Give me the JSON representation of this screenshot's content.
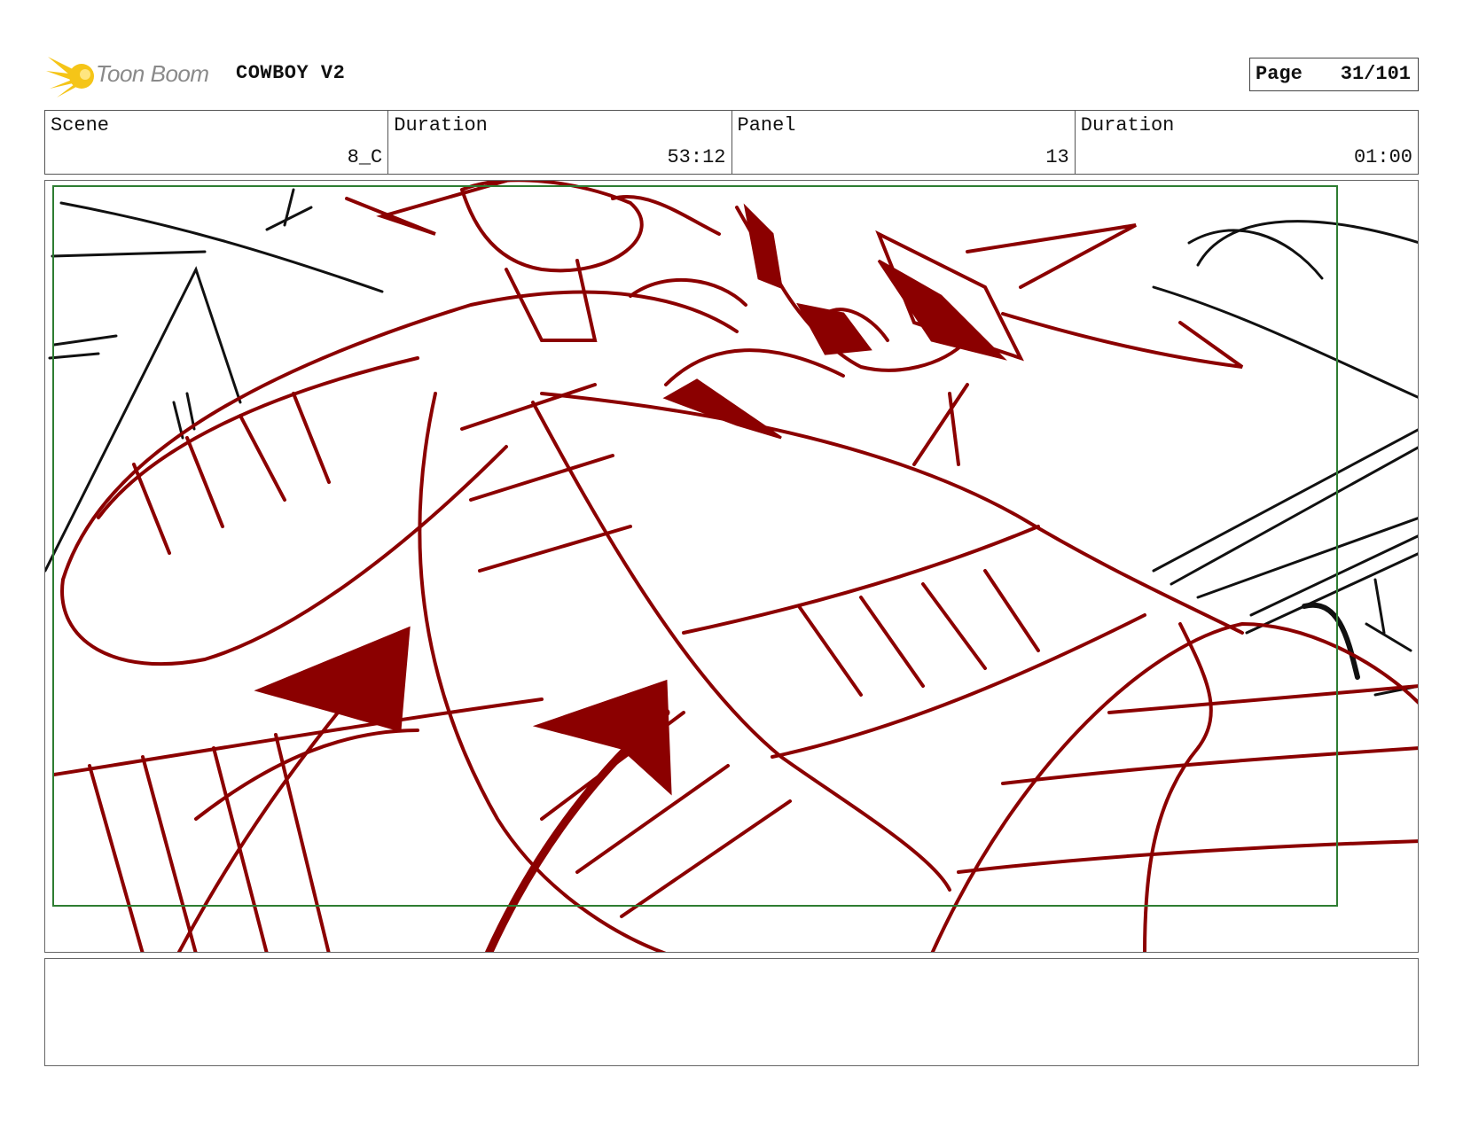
{
  "header": {
    "logo_text": "Toon Boom",
    "project_title": "COWBOY V2",
    "page_label": "Page",
    "page_number": "31/101"
  },
  "info": {
    "scene_label": "Scene",
    "scene_value": "8_C",
    "scene_duration_label": "Duration",
    "scene_duration_value": "53:12",
    "panel_label": "Panel",
    "panel_value": "13",
    "panel_duration_label": "Duration",
    "panel_duration_value": "01:00"
  },
  "colors": {
    "sketch_red": "#8b0000",
    "sketch_black": "#111111",
    "safe_frame_green": "#2e7d32",
    "logo_yellow": "#f5c518"
  },
  "icons": [
    "toon-boom-logo-icon"
  ]
}
